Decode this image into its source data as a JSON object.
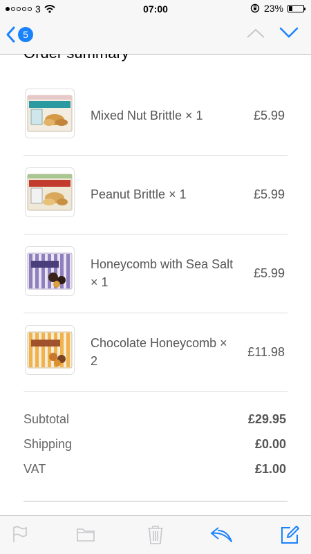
{
  "status_bar": {
    "carrier": "3",
    "time": "07:00",
    "battery": "23%",
    "battery_level": 0.23
  },
  "nav": {
    "back_count": "5",
    "colors": {
      "accent": "#1a82fb",
      "disabled": "#c7c7cc"
    }
  },
  "order": {
    "title": "Order summary",
    "items": [
      {
        "name": "Mixed Nut Brittle × 1",
        "price": "£5.99",
        "icon": "mixed-nut-brittle-box"
      },
      {
        "name": "Peanut Brittle × 1",
        "price": "£5.99",
        "icon": "peanut-brittle-box"
      },
      {
        "name": "Honeycomb with Sea Salt × 1",
        "price": "£5.99",
        "icon": "honeycomb-sea-salt-box"
      },
      {
        "name": "Chocolate Honeycomb × 2",
        "price": "£11.98",
        "icon": "chocolate-honeycomb-box"
      }
    ],
    "totals": [
      {
        "label": "Subtotal",
        "value": "£29.95"
      },
      {
        "label": "Shipping",
        "value": "£0.00"
      },
      {
        "label": "VAT",
        "value": "£1.00"
      }
    ]
  },
  "toolbar": {
    "icons": [
      "flag-icon",
      "folder-icon",
      "trash-icon",
      "reply-icon",
      "compose-icon"
    ]
  }
}
